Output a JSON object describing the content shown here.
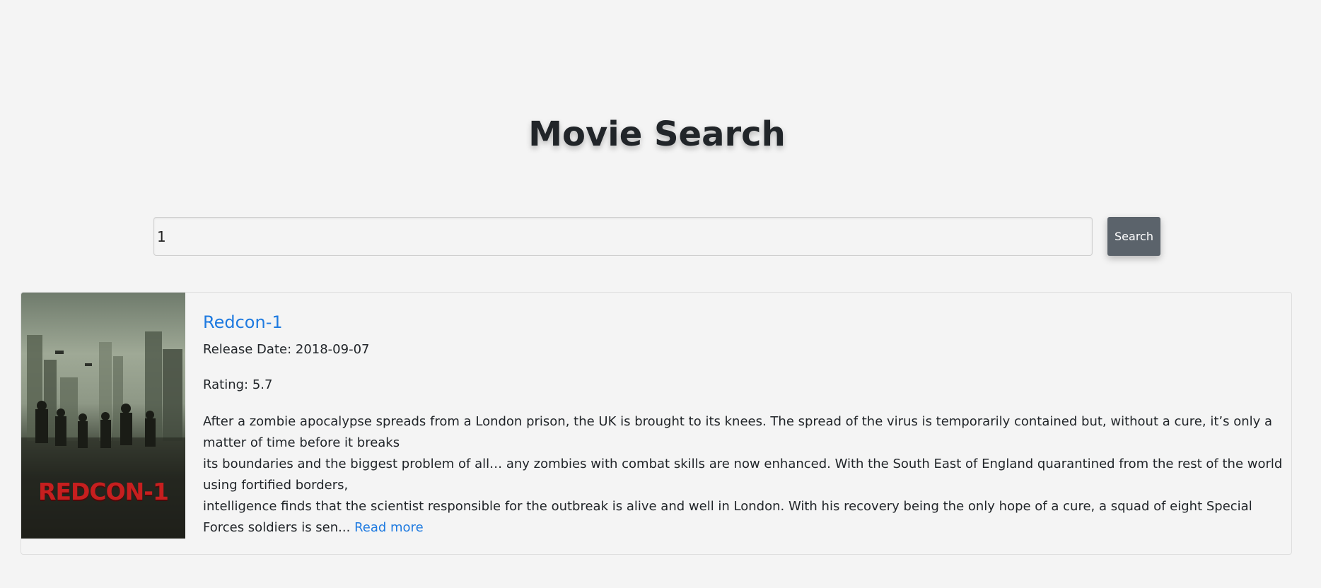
{
  "header": {
    "title": "Movie Search"
  },
  "search": {
    "value": "1",
    "placeholder": "",
    "button_label": "Search"
  },
  "results": [
    {
      "title": "Redcon-1",
      "poster_text": "REDCON-1",
      "release_label": "Release Date: 2018-09-07",
      "rating_label": "Rating: 5.7",
      "overview_lines": [
        "After a zombie apocalypse spreads from a London prison, the UK is brought to its knees. The spread of the virus is temporarily contained but, without a cure, it’s only a matter of time before it breaks",
        "its boundaries and the biggest problem of all… any zombies with combat skills are now enhanced. With the South East of England quarantined from the rest of the world using fortified borders,",
        "intelligence finds that the scientist responsible for the outbreak is alive and well in London. With his recovery being the only hope of a cure, a squad of eight Special Forces soldiers is sen..."
      ],
      "read_more_label": "Read more"
    }
  ],
  "colors": {
    "accent": "#1e7ae0",
    "button": "#5b636b",
    "background": "#f4f4f4"
  }
}
